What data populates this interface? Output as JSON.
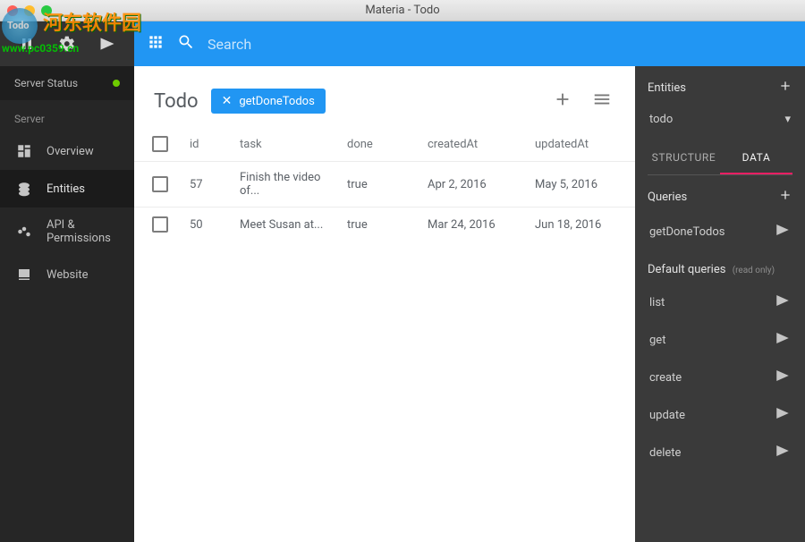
{
  "window": {
    "title": "Materia - Todo"
  },
  "watermark": {
    "text": "河东软件园",
    "url": "www.pc0359.cn"
  },
  "topbar": {
    "search_placeholder": "Search"
  },
  "sidebar": {
    "server_status_label": "Server Status",
    "section_label": "Server",
    "items": [
      {
        "label": "Overview"
      },
      {
        "label": "Entities"
      },
      {
        "label": "API & Permissions"
      },
      {
        "label": "Website"
      }
    ]
  },
  "content": {
    "title": "Todo",
    "chip": "getDoneTodos",
    "columns": [
      "id",
      "task",
      "done",
      "createdAt",
      "updatedAt"
    ],
    "rows": [
      {
        "id": "57",
        "task": "Finish the video of...",
        "done": "true",
        "createdAt": "Apr 2, 2016",
        "updatedAt": "May 5, 2016"
      },
      {
        "id": "50",
        "task": "Meet Susan at...",
        "done": "true",
        "createdAt": "Mar 24, 2016",
        "updatedAt": "Jun 18, 2016"
      }
    ]
  },
  "right": {
    "entities_label": "Entities",
    "selected_entity": "todo",
    "tabs": {
      "structure": "STRUCTURE",
      "data": "DATA"
    },
    "queries_label": "Queries",
    "queries": [
      {
        "name": "getDoneTodos"
      }
    ],
    "default_label": "Default queries",
    "default_hint": "(read only)",
    "default_queries": [
      {
        "name": "list"
      },
      {
        "name": "get"
      },
      {
        "name": "create"
      },
      {
        "name": "update"
      },
      {
        "name": "delete"
      }
    ]
  }
}
